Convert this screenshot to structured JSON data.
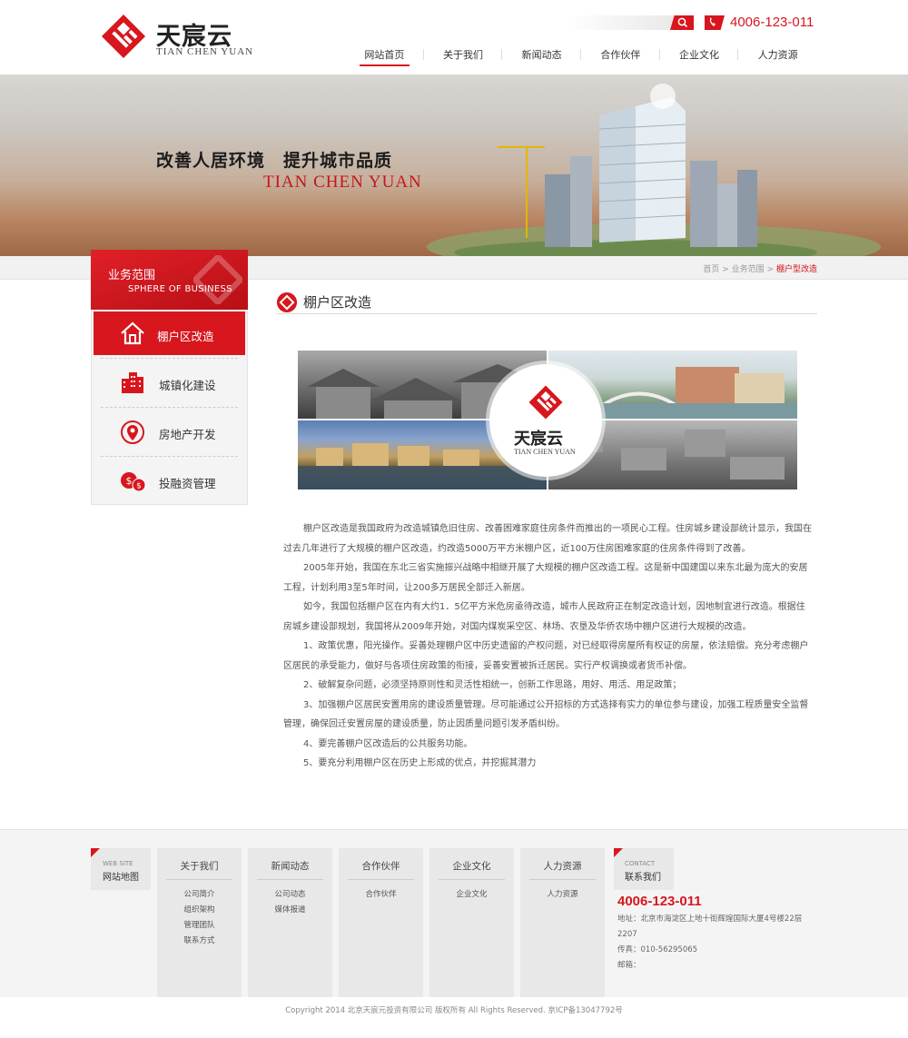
{
  "header": {
    "logo_cn": "天宸云",
    "logo_en": "TIAN CHEN YUAN",
    "search_placeholder": "",
    "phone": "4006-123-011",
    "brand_color": "#d7161e",
    "nav": [
      {
        "label": "网站首页",
        "active": true
      },
      {
        "label": "关于我们",
        "active": false
      },
      {
        "label": "新闻动态",
        "active": false
      },
      {
        "label": "合作伙伴",
        "active": false
      },
      {
        "label": "企业文化",
        "active": false
      },
      {
        "label": "人力资源",
        "active": false
      }
    ]
  },
  "banner": {
    "slogan": "改善人居环境　提升城市品质",
    "slogan_en": "TIAN CHEN YUAN"
  },
  "breadcrumb": {
    "home": "首页",
    "sep": ">",
    "section": "业务范围",
    "current": "棚户型改造"
  },
  "sidebar": {
    "title_cn": "业务范围",
    "title_en": "SPHERE OF BUSINESS",
    "items": [
      {
        "label": "棚户区改造",
        "icon": "house-icon",
        "active": true
      },
      {
        "label": "城镇化建设",
        "icon": "buildings-icon",
        "active": false
      },
      {
        "label": "房地产开发",
        "icon": "location-pin-icon",
        "active": false
      },
      {
        "label": "投融资管理",
        "icon": "coins-icon",
        "active": false
      }
    ]
  },
  "content": {
    "title": "棚户区改造",
    "image_logo_cn": "天宸云",
    "image_logo_en": "TIAN CHEN YUAN",
    "paragraphs": [
      "棚户区改造是我国政府为改造城镇危旧住房、改善困难家庭住房条件而推出的一项民心工程。住房城乡建设部统计显示，我国在过去几年进行了大规模的棚户区改造，约改造5000万平方米棚户区，近100万住房困难家庭的住房条件得到了改善。",
      "2005年开始，我国在东北三省实施振兴战略中相继开展了大规模的棚户区改造工程。这是新中国建国以来东北最为庞大的安居工程，计划利用3至5年时间，让200多万居民全部迁入新居。",
      "如今，我国包括棚户区在内有大约1．5亿平方米危房亟待改造，城市人民政府正在制定改造计划，因地制宜进行改造。根据住房城乡建设部规划，我国将从2009年开始，对国内煤炭采空区、林场、农垦及华侨农场中棚户区进行大规模的改造。",
      "1、政策优惠，阳光操作。妥善处理棚户区中历史遗留的产权问题，对已经取得房屋所有权证的房屋，依法赔偿。充分考虑棚户区居民的承受能力，做好与各项住房政策的衔接，妥善安置被拆迁居民。实行产权调换或者货币补偿。",
      "2、破解复杂问题，必须坚持原则性和灵活性相统一，创新工作思路，用好、用活、用足政策；",
      "3、加强棚户区居民安置用房的建设质量管理。尽可能通过公开招标的方式选择有实力的单位参与建设，加强工程质量安全监督管理，确保回迁安置房屋的建设质量，防止因质量问题引发矛盾纠纷。",
      "4、要完善棚户区改造后的公共服务功能。",
      "5、要充分利用棚户区在历史上形成的优点，并挖掘其潜力"
    ]
  },
  "footer": {
    "sitemap_en": "WEB SITE",
    "sitemap_cn": "网站地图",
    "columns": [
      {
        "title": "关于我们",
        "links": [
          "公司简介",
          "组织架构",
          "管理团队",
          "联系方式"
        ]
      },
      {
        "title": "新闻动态",
        "links": [
          "公司动态",
          "媒体报道"
        ]
      },
      {
        "title": "合作伙伴",
        "links": [
          "合作伙伴"
        ]
      },
      {
        "title": "企业文化",
        "links": [
          "企业文化"
        ]
      },
      {
        "title": "人力资源",
        "links": [
          "人力资源"
        ]
      }
    ],
    "contact_en": "CONTACT",
    "contact_cn": "联系我们",
    "phone": "4006-123-011",
    "address": "地址：北京市海淀区上地十街辉煌国际大厦4号楼22层2207",
    "fax": "传真：010-56295065",
    "email": "邮箱：",
    "copyright": "Copyright 2014 北京天宸元投资有限公司 版权所有 All Rights Reserved.  京ICP备13047792号"
  }
}
